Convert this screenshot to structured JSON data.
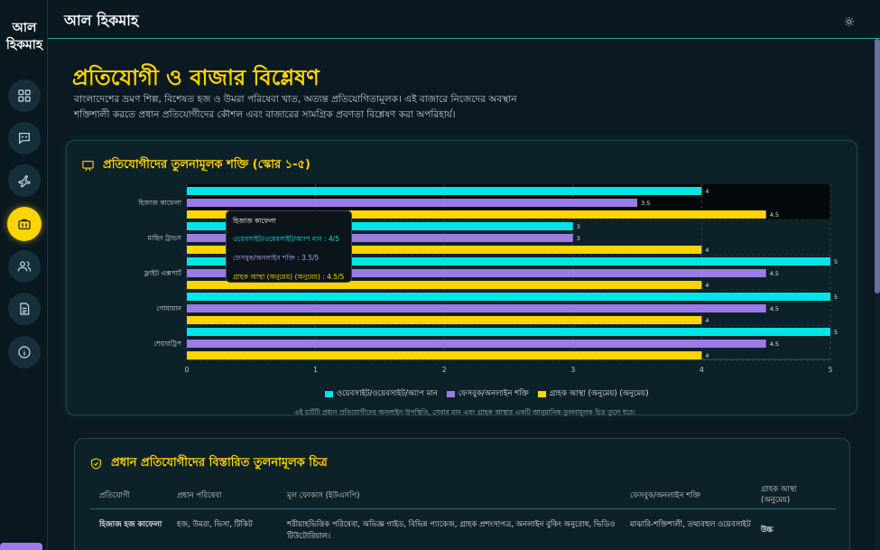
{
  "app": {
    "logo": "আল হিকমাহ",
    "header_title": "আল হিকমাহ"
  },
  "sidebar": {
    "items": [
      {
        "icon": "dashboard-icon"
      },
      {
        "icon": "chat-icon"
      },
      {
        "icon": "plane-icon"
      },
      {
        "icon": "briefcase-icon",
        "active": true
      },
      {
        "icon": "users-icon"
      },
      {
        "icon": "document-icon"
      },
      {
        "icon": "info-icon"
      }
    ]
  },
  "page": {
    "title": "প্রতিযোগী ও বাজার বিশ্লেষণ",
    "description": "বাংলাদেশের ভ্রমণ শিল্প, বিশেষত হজ ও উমরা পরিষেবা খাত, অত্যন্ত প্রতিযোগিতামূলক। এই বাজারে নিজেদের অবস্থান শক্তিশালী করতে প্রধান প্রতিযোগীদের কৌশল এবং বাজারের সামগ্রিক প্রবণতা বিশ্লেষণ করা অপরিহার্য।"
  },
  "chart_card": {
    "heading": "প্রতিযোগীদের তুলনামূলক শক্তি (স্কোর ১-৫)",
    "note": "এই চার্টটি প্রধান প্রতিযোগীদের অনলাইন উপস্থিতি, সেবার মান এবং গ্রাহক আস্থার একটি আনুমানিক তুলনামূলক চিত্র তুলে ধরে।"
  },
  "chart_data": {
    "type": "bar",
    "orientation": "horizontal",
    "categories": [
      "হিজাজ কাফেলা",
      "মাহিন ট্রাভস",
      "ফ্লাইট এক্সপার্ট",
      "গোযায়ান",
      "শেয়ারট্রিপ"
    ],
    "series": [
      {
        "name": "ওয়েবসাইট/ওয়েবসাইট/অ্যাপ মান",
        "color": "#00e5e5",
        "values": [
          4,
          3,
          5,
          5,
          5
        ]
      },
      {
        "name": "ফেসবুক/অনলাইন শক্তি",
        "color": "#9c7be8",
        "values": [
          3.5,
          3,
          4.5,
          4.5,
          4.5
        ]
      },
      {
        "name": "গ্রাহক আস্থা (অনুমেয়) (অনুমেয়)",
        "color": "#ffd500",
        "values": [
          4.5,
          4,
          4,
          4,
          4
        ]
      }
    ],
    "xlim": [
      0,
      5
    ],
    "xticks": [
      "0",
      "1",
      "2",
      "3",
      "4",
      "5"
    ],
    "legend": "bottom",
    "grid": true
  },
  "tooltip": {
    "title": "হিজাজ কাফেলা",
    "row1": "ওয়েবসাইট/ওয়েবসাইট/অ্যাপ মান : 4/5",
    "row2": "ফেসবুক/অনলাইন শক্তি : 3.5/5",
    "row3": "গ্রাহক আস্থা (অনুমেয়) (অনুমেয়) : 4.5/5"
  },
  "table_card": {
    "heading": "প্রধান প্রতিযোগীদের বিস্তারিত তুলনামূলক চিত্র",
    "headers": [
      "প্রতিযোগী",
      "প্রধান পরিষেবা",
      "মূল ফোকাস (ইউএসপি)",
      "ফেসবুক/অনলাইন শক্তি",
      "গ্রাহক আস্থা (অনুমেয়)"
    ],
    "rows": [
      {
        "name": "হিজাজ হজ কাফেলা",
        "services": "হজ, উমরা, ভিসা, টিকিট",
        "focus": "শরীয়াহভিত্তিক পরিষেবা, অভিজ্ঞ গাইড, বিভিন্ন প্যাকেজ, গ্রাহক প্রশংসাপত্র, অনলাইন বুকিং অনুরোধ, ভিডিও টিউটোরিয়াল।",
        "online": "মাঝারি-শক্তিশালী, তথ্যবহুল ওয়েবসাইট",
        "trust": "উচ্চ"
      }
    ]
  },
  "colors": {
    "accent": "#ffd500",
    "teal": "#00e5e5",
    "purple": "#9c7be8",
    "background": "#0b1a22"
  }
}
